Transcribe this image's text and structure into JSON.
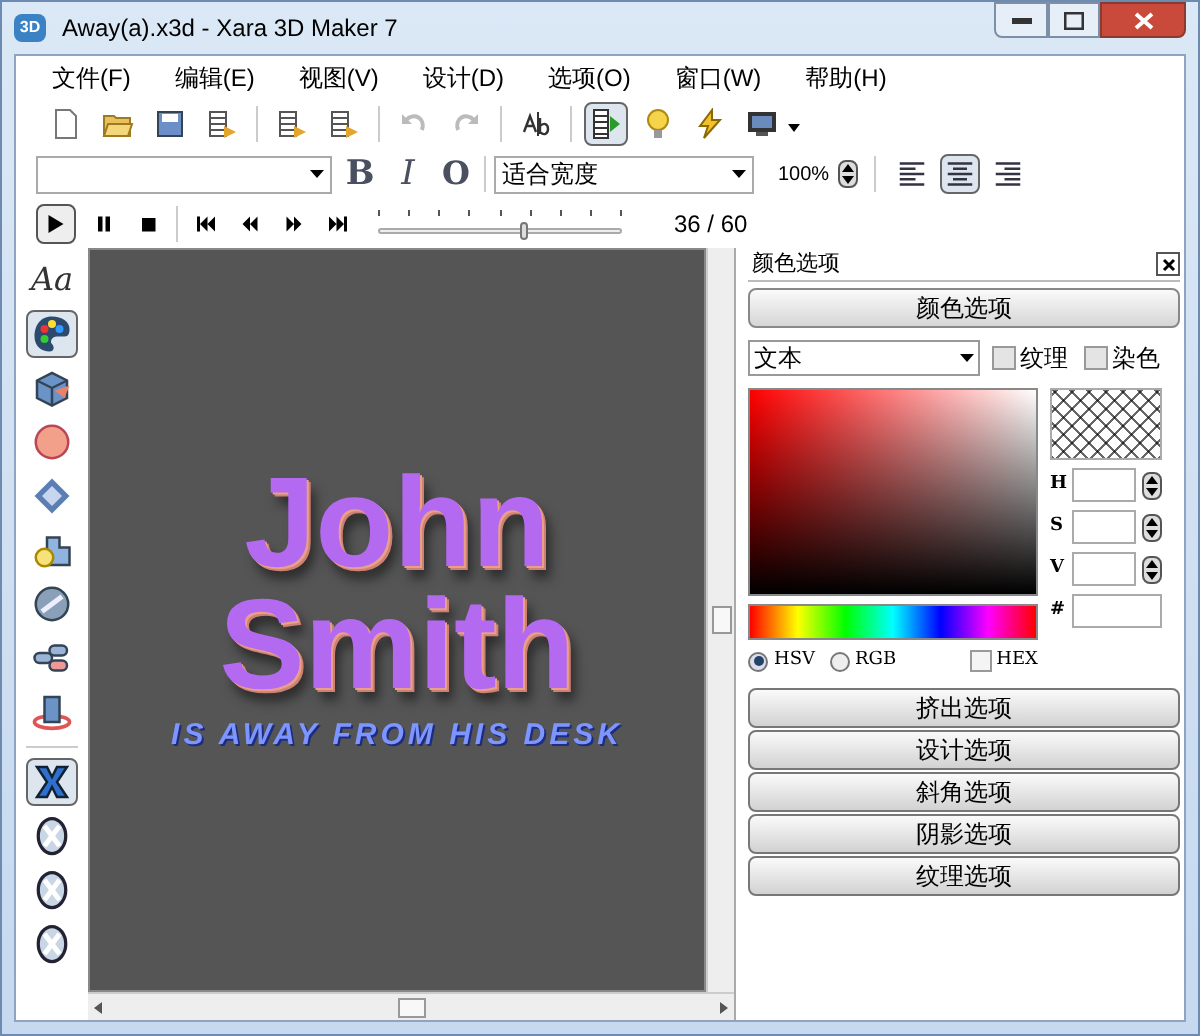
{
  "window": {
    "title": "Away(a).x3d - Xara 3D Maker 7",
    "logo": "3D"
  },
  "menu": [
    "文件(F)",
    "编辑(E)",
    "视图(V)",
    "设计(D)",
    "选项(O)",
    "窗口(W)",
    "帮助(H)"
  ],
  "main_toolbar": [
    {
      "kind": "new",
      "selected": false
    },
    {
      "kind": "open",
      "selected": false
    },
    {
      "kind": "save",
      "selected": false
    },
    {
      "kind": "export",
      "selected": false
    },
    {
      "kind": "sep"
    },
    {
      "kind": "export",
      "selected": false
    },
    {
      "kind": "export",
      "selected": false
    },
    {
      "kind": "sep"
    },
    {
      "kind": "undo",
      "selected": false
    },
    {
      "kind": "redo",
      "selected": false
    },
    {
      "kind": "sep"
    },
    {
      "kind": "text",
      "selected": false
    },
    {
      "kind": "sep"
    },
    {
      "kind": "film",
      "selected": true
    },
    {
      "kind": "bulb",
      "selected": false
    },
    {
      "kind": "bolt",
      "selected": false
    },
    {
      "kind": "monitor",
      "selected": false
    }
  ],
  "format_toolbar": {
    "style_buttons": [
      "B",
      "I",
      "O"
    ],
    "size_combo": "适合宽度",
    "zoom": "100%",
    "align": [
      {
        "selected": false
      },
      {
        "selected": true
      },
      {
        "selected": false
      }
    ]
  },
  "playback": {
    "frame": "36 / 60",
    "level": 0.6
  },
  "tools": [
    {
      "kind": "text",
      "label": "Aa",
      "selected": false
    },
    {
      "kind": "palette",
      "selected": true
    },
    {
      "kind": "extrude",
      "selected": false
    },
    {
      "kind": "ball",
      "selected": false
    },
    {
      "kind": "bevel",
      "selected": false
    },
    {
      "kind": "light",
      "selected": false
    },
    {
      "kind": "disc",
      "selected": false
    },
    {
      "kind": "rolls",
      "selected": false
    },
    {
      "kind": "rotate",
      "selected": false
    },
    {
      "kind": "sep"
    },
    {
      "kind": "x",
      "selected": true
    },
    {
      "kind": "xcircle",
      "selected": false
    },
    {
      "kind": "xcircle",
      "selected": false
    },
    {
      "kind": "xcircle",
      "selected": false
    }
  ],
  "canvas": {
    "lines": [
      "John",
      "Smith"
    ],
    "subtitle": "IS AWAY FROM HIS DESK"
  },
  "panel": {
    "title": "颜色选项",
    "section": "颜色选项",
    "target": "文本",
    "checks": [
      {
        "label": "纹理",
        "checked": false
      },
      {
        "label": "染色",
        "checked": false
      }
    ],
    "fields": [
      "H",
      "S",
      "V",
      "#"
    ],
    "modes": [
      {
        "label": "HSV",
        "selected": true
      },
      {
        "label": "RGB",
        "selected": false
      }
    ],
    "hex": {
      "label": "HEX",
      "checked": false
    },
    "sections": [
      "挤出选项",
      "设计选项",
      "斜角选项",
      "阴影选项",
      "纹理选项"
    ]
  }
}
